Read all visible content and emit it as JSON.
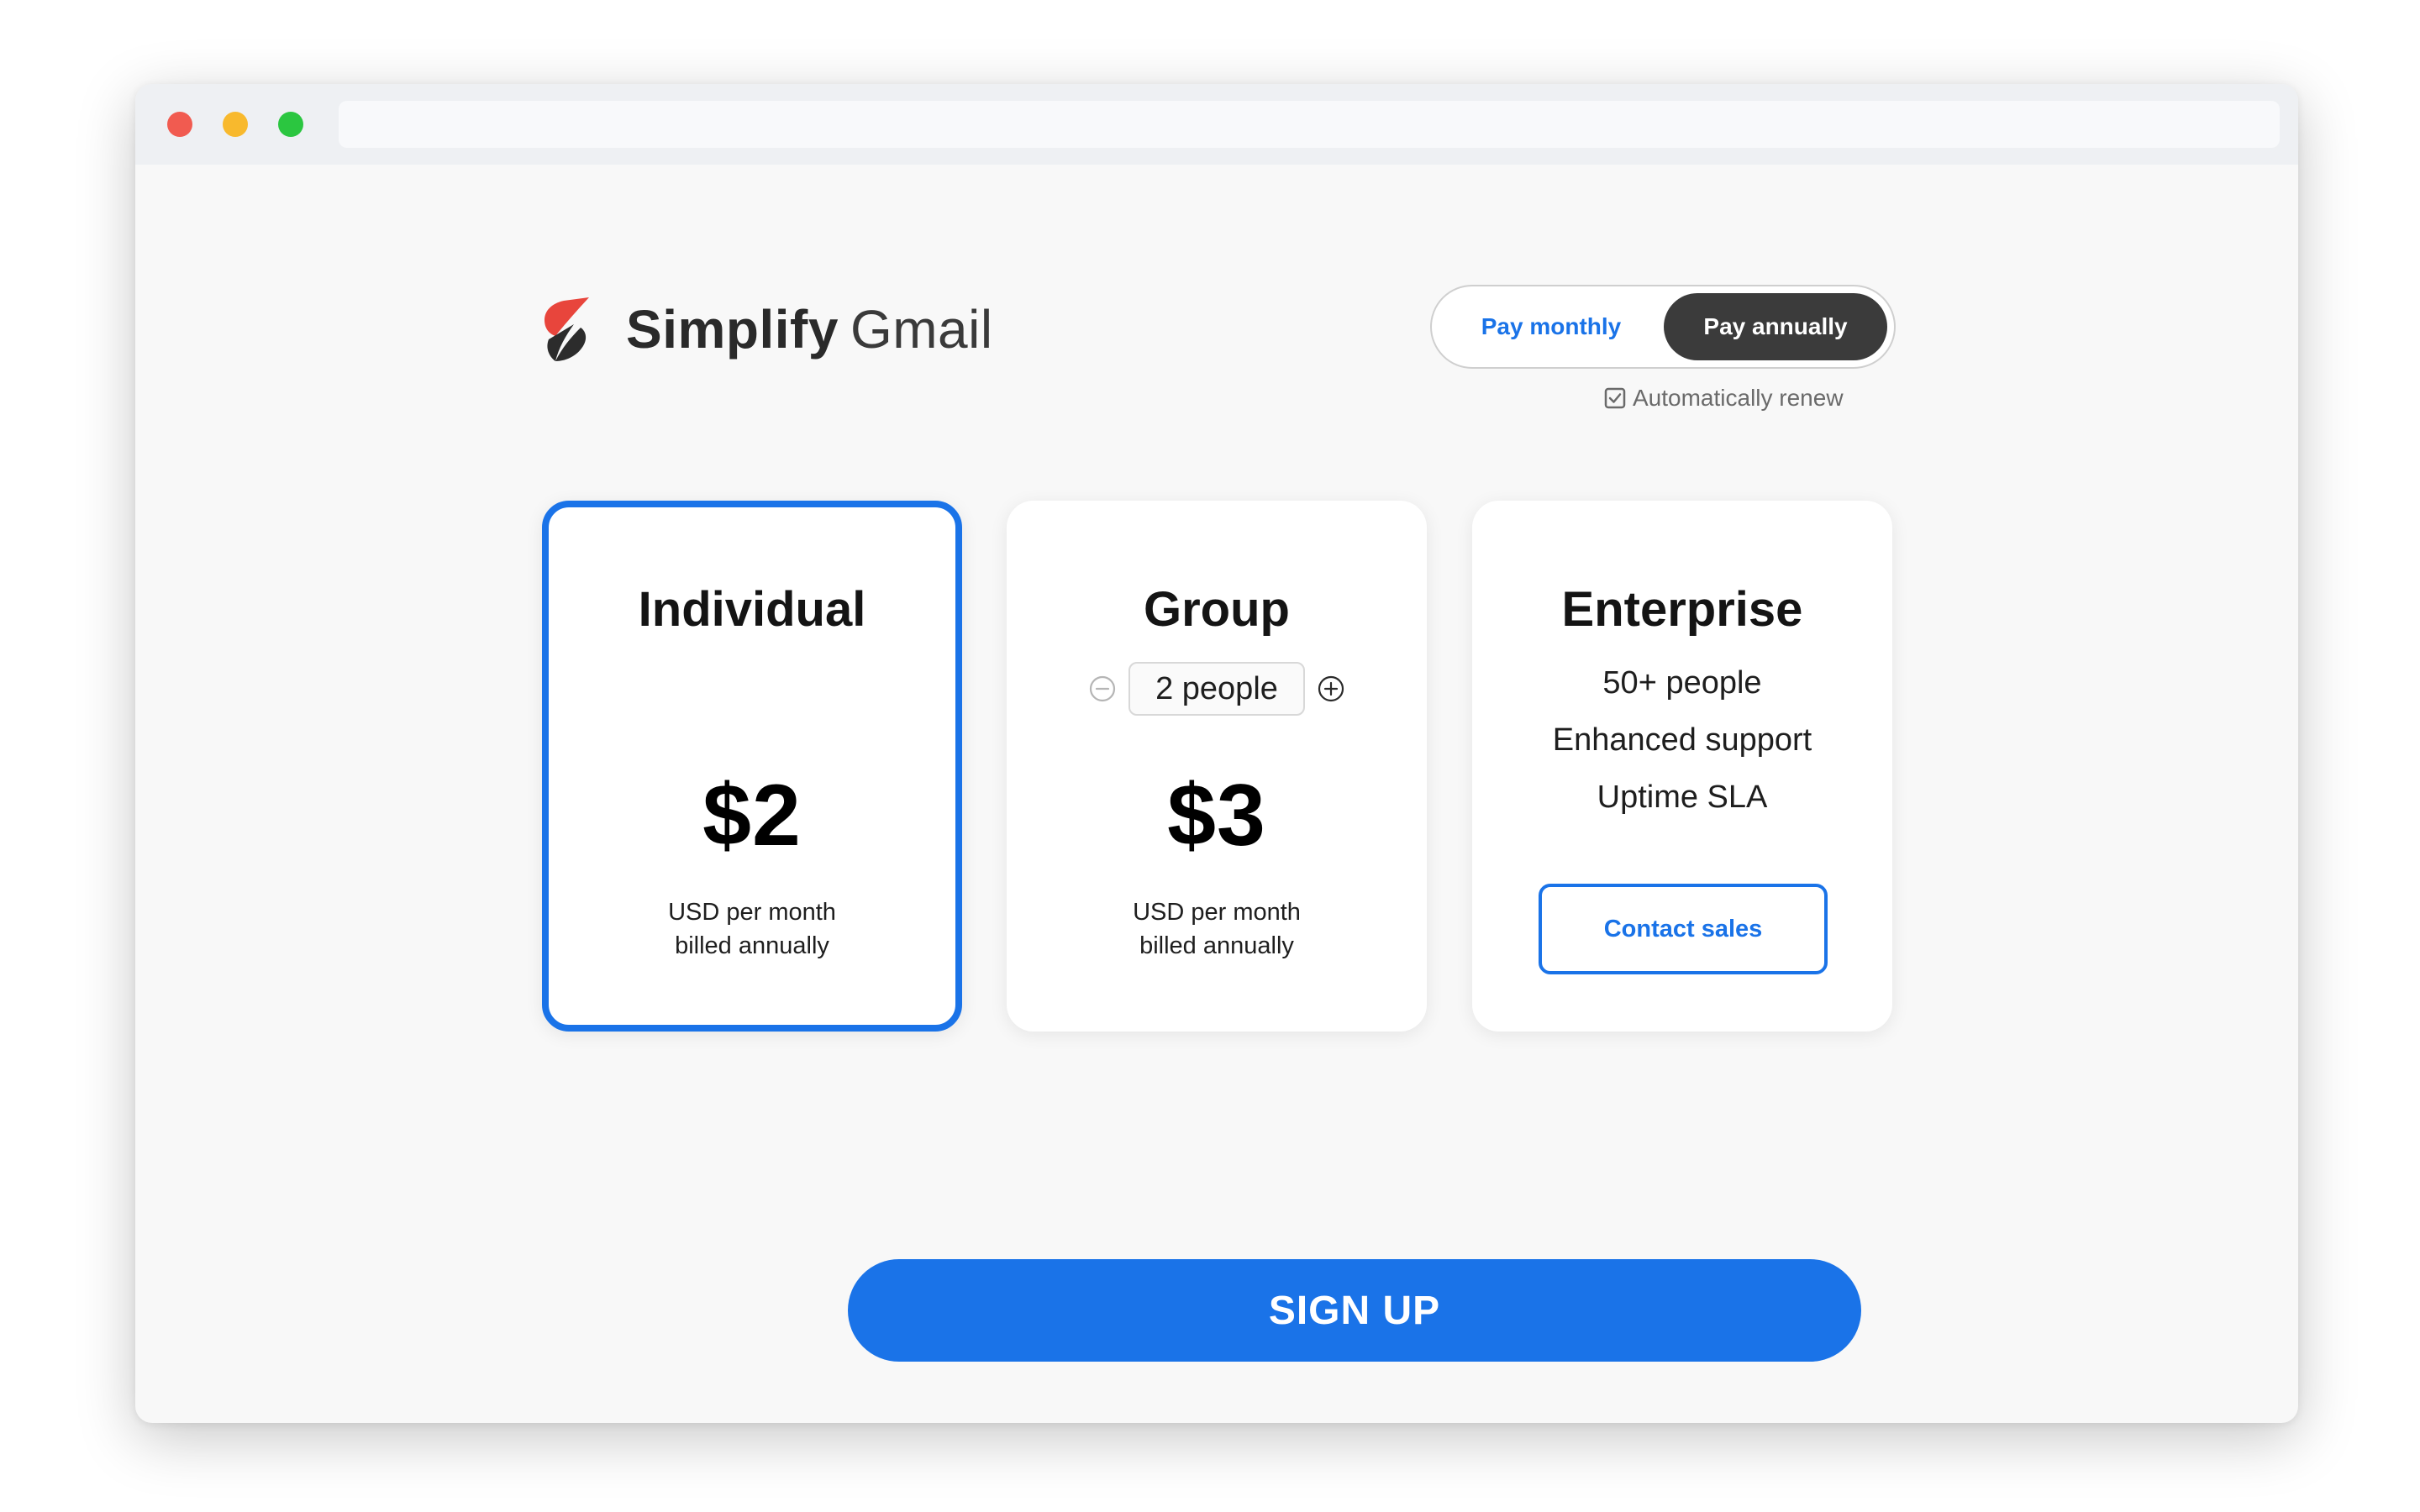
{
  "window": {
    "controls": {
      "close_color": "#f15b50",
      "minimize_color": "#f8b92d",
      "maximize_color": "#2bc640"
    },
    "address_bar": {
      "value": ""
    }
  },
  "brand": {
    "logo_icon": "simplify-logo-icon",
    "logo_colors": {
      "primary": "#e8453c",
      "secondary": "#2c2c2c"
    },
    "name_bold": "Simplify",
    "name_light": "Gmail"
  },
  "billing": {
    "options": [
      {
        "label": "Pay monthly",
        "selected": false
      },
      {
        "label": "Pay annually",
        "selected": true
      }
    ],
    "auto_renew": {
      "label": "Automatically renew",
      "checked": true,
      "icon": "checkbox-checked-icon"
    }
  },
  "plans": [
    {
      "name": "Individual",
      "price": "$2",
      "note_line1": "USD per month",
      "note_line2": "billed annually",
      "selected": true
    },
    {
      "name": "Group",
      "people_value": "2 people",
      "decrement_icon": "minus-circle-icon",
      "increment_icon": "plus-circle-icon",
      "price": "$3",
      "note_line1": "USD per month",
      "note_line2": "billed annually",
      "selected": false
    },
    {
      "name": "Enterprise",
      "features": [
        "50+ people",
        "Enhanced support",
        "Uptime SLA"
      ],
      "cta_label": "Contact sales",
      "selected": false
    }
  ],
  "signup": {
    "label": "SIGN UP"
  },
  "colors": {
    "accent": "#1a73e8",
    "toggle_active": "#3b3b3b",
    "page_background": "#f8f8f8",
    "card_background": "#ffffff"
  }
}
